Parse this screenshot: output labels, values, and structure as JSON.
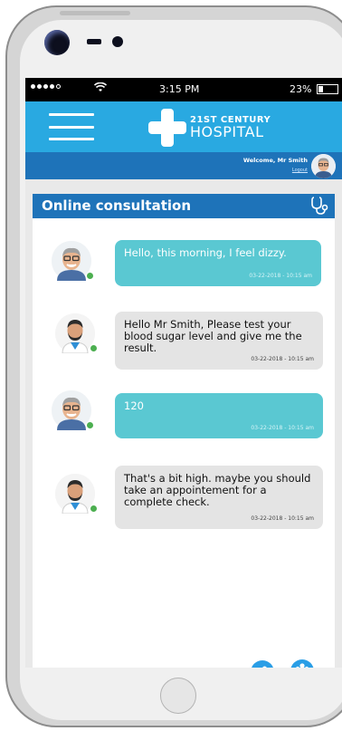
{
  "status_bar": {
    "time": "3:15 PM",
    "battery": "23%"
  },
  "header": {
    "logo_line1": "21ST CENTURY",
    "logo_line2": "HOSPITAL"
  },
  "welcome": {
    "text": "Welcome, Mr Smith",
    "logout": "Logout"
  },
  "consultation": {
    "title": "Online consultation",
    "messages": [
      {
        "sender": "patient",
        "text": "Hello, this morning, I feel dizzy.",
        "timestamp": "03-22-2018 - 10:15 am"
      },
      {
        "sender": "doctor",
        "text": "Hello Mr Smith, Please test your blood sugar level and give me the result.",
        "timestamp": "03-22-2018 - 10:15 am"
      },
      {
        "sender": "patient",
        "text": "120",
        "timestamp": "03-22-2018 - 10:15 am"
      },
      {
        "sender": "doctor",
        "text": "That's a bit high. maybe you should take an appointement for a complete check.",
        "timestamp": "03-22-2018 - 10:15 am"
      }
    ],
    "input_value": ""
  },
  "colors": {
    "header_blue": "#29a9e1",
    "dark_blue": "#1e73b9",
    "patient_bubble": "#5ac8d2",
    "doctor_bubble": "#e4e4e4",
    "online": "#4caf50"
  },
  "icons": {
    "stethoscope": "stethoscope-icon",
    "attach": "paperclip-icon",
    "group": "group-icon"
  }
}
